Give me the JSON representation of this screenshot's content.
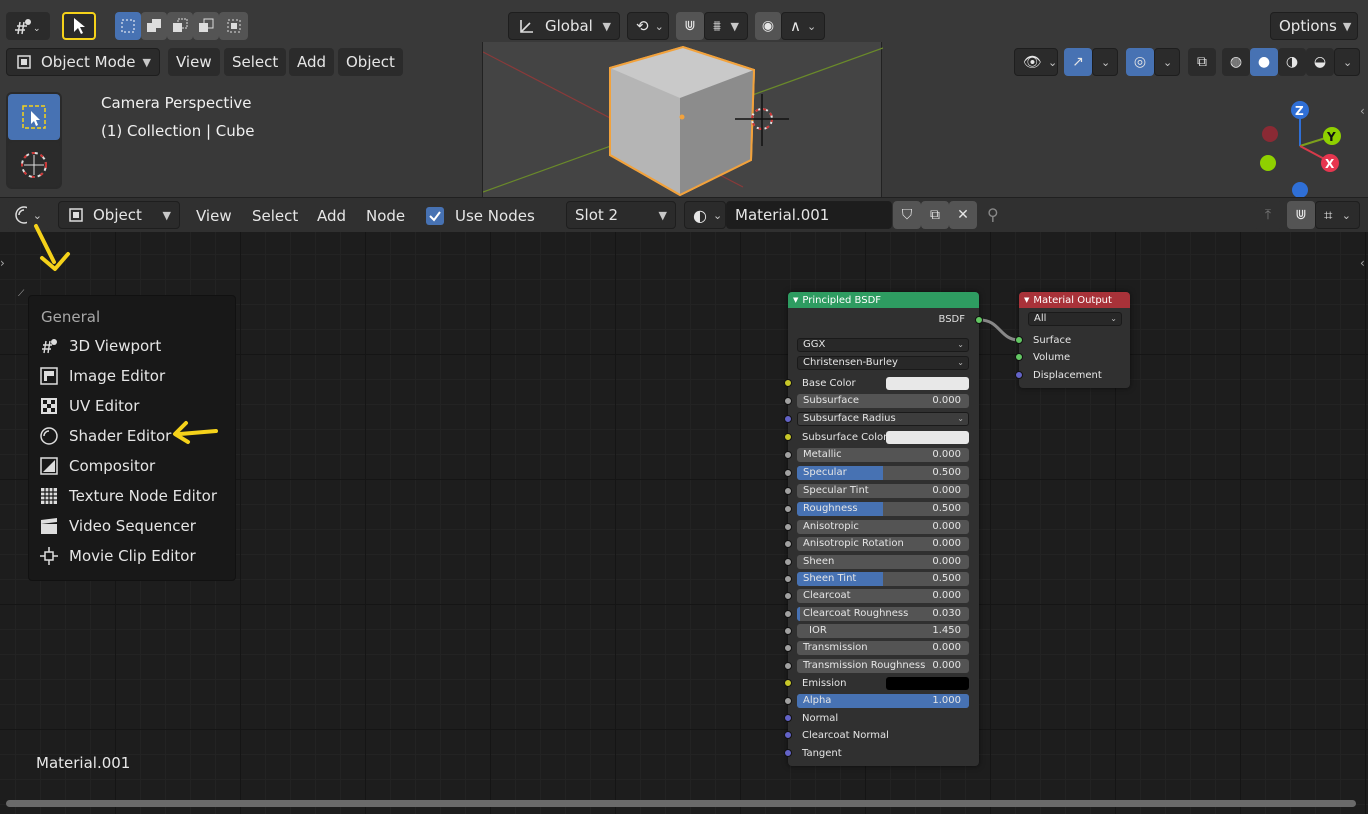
{
  "viewport": {
    "orientation_label": "Global",
    "options_label": "Options",
    "mode_label": "Object Mode",
    "menu": [
      "View",
      "Select",
      "Add",
      "Object"
    ],
    "info_line1": "Camera Perspective",
    "info_line2": "(1) Collection | Cube",
    "gizmo_axes": {
      "z": "Z",
      "y": "Y",
      "x": "X"
    }
  },
  "node_header": {
    "object_dropdown": "Object",
    "menu": [
      "View",
      "Select",
      "Add",
      "Node"
    ],
    "use_nodes_label": "Use Nodes",
    "use_nodes_checked": true,
    "slot_label": "Slot 2",
    "material_name": "Material.001"
  },
  "editor_menu": {
    "heading": "General",
    "items": [
      {
        "label": "3D Viewport",
        "icon": "3d-viewport-icon"
      },
      {
        "label": "Image Editor",
        "icon": "image-editor-icon"
      },
      {
        "label": "UV Editor",
        "icon": "uv-editor-icon"
      },
      {
        "label": "Shader Editor",
        "icon": "shader-editor-icon"
      },
      {
        "label": "Compositor",
        "icon": "compositor-icon"
      },
      {
        "label": "Texture Node Editor",
        "icon": "texture-node-icon"
      },
      {
        "label": "Video Sequencer",
        "icon": "video-sequencer-icon"
      },
      {
        "label": "Movie Clip Editor",
        "icon": "movie-clip-icon"
      }
    ]
  },
  "principled_node": {
    "title": "Principled BSDF",
    "output_label": "BSDF",
    "distribution": "GGX",
    "subsurface_method": "Christensen-Burley",
    "base_color_label": "Base Color",
    "subsurface_radius_label": "Subsurface Radius",
    "subsurface_color_label": "Subsurface Color",
    "emission_label": "Emission",
    "fields": [
      {
        "label": "Subsurface",
        "value": "0.000",
        "fraction": 0
      },
      {
        "label": "Metallic",
        "value": "0.000",
        "fraction": 0
      },
      {
        "label": "Specular",
        "value": "0.500",
        "fraction": 0.5
      },
      {
        "label": "Specular Tint",
        "value": "0.000",
        "fraction": 0
      },
      {
        "label": "Roughness",
        "value": "0.500",
        "fraction": 0.5
      },
      {
        "label": "Anisotropic",
        "value": "0.000",
        "fraction": 0
      },
      {
        "label": "Anisotropic Rotation",
        "value": "0.000",
        "fraction": 0
      },
      {
        "label": "Sheen",
        "value": "0.000",
        "fraction": 0
      },
      {
        "label": "Sheen Tint",
        "value": "0.500",
        "fraction": 0.5
      },
      {
        "label": "Clearcoat",
        "value": "0.000",
        "fraction": 0
      },
      {
        "label": "Clearcoat Roughness",
        "value": "0.030",
        "fraction": 0.03
      },
      {
        "label": "IOR",
        "value": "1.450",
        "fraction": 0
      },
      {
        "label": "Transmission",
        "value": "0.000",
        "fraction": 0
      },
      {
        "label": "Transmission Roughness",
        "value": "0.000",
        "fraction": 0
      },
      {
        "label": "Alpha",
        "value": "1.000",
        "fraction": 1
      }
    ],
    "vector_inputs": [
      "Normal",
      "Clearcoat Normal",
      "Tangent"
    ]
  },
  "output_node": {
    "title": "Material Output",
    "target": "All",
    "inputs": [
      "Surface",
      "Volume",
      "Displacement"
    ]
  },
  "colors": {
    "principled_header": "#2e9c61",
    "output_header": "#a83239",
    "accent_blue": "#4772b3",
    "arrow_yellow": "#f5d21a",
    "selection_orange": "#f2a23c"
  }
}
